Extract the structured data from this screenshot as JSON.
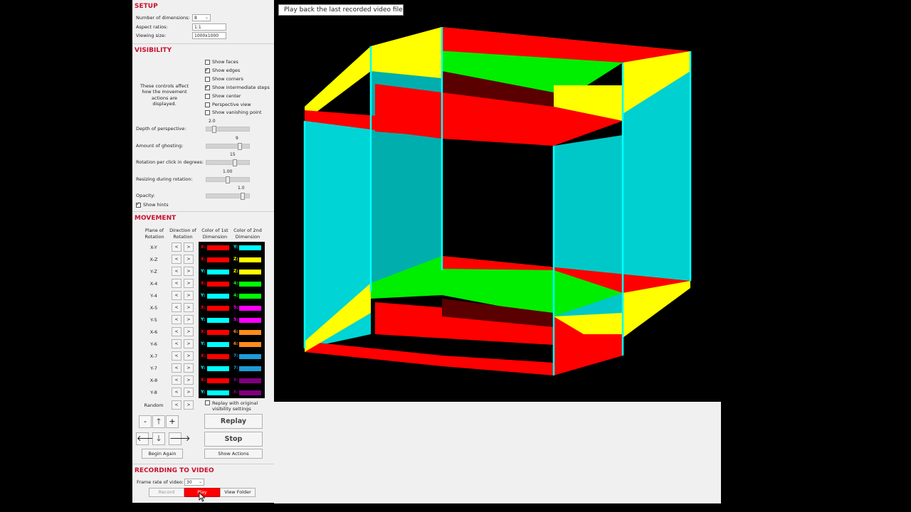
{
  "setup": {
    "title": "SETUP",
    "dimensions_label": "Number of dimensions:",
    "dimensions_value": "8",
    "aspect_label": "Aspect ratios:",
    "aspect_value": "1:1",
    "viewing_label": "Viewing size:",
    "viewing_value": "1000x1000"
  },
  "visibility": {
    "title": "VISIBILITY",
    "hint_text": "These controls affect how the movement actions are displayed.",
    "checkboxes": [
      {
        "label": "Show faces",
        "checked": false
      },
      {
        "label": "Show edges",
        "checked": true
      },
      {
        "label": "Show corners",
        "checked": false
      },
      {
        "label": "Show intermediate steps",
        "checked": true
      },
      {
        "label": "Show center",
        "checked": false
      },
      {
        "label": "Perspective view",
        "checked": false
      },
      {
        "label": "Show vanishing point",
        "checked": false
      }
    ],
    "sliders": [
      {
        "label": "Depth of perspective:",
        "value": "2.0",
        "level": 0.15
      },
      {
        "label": "Amount of ghosting:",
        "value": "9",
        "level": 0.82
      },
      {
        "label": "Rotation per click in degrees:",
        "value": "15",
        "level": 0.68
      },
      {
        "label": "Resizing during rotation:",
        "value": "1.00",
        "level": 0.5
      },
      {
        "label": "Opacity:",
        "value": "1.0",
        "level": 0.88
      }
    ],
    "show_hints_label": "Show hints",
    "show_hints_checked": true
  },
  "movement": {
    "title": "MOVEMENT",
    "headers": {
      "plane": "Plane of Rotation",
      "direction": "Direction of Rotation",
      "color1": "Color of 1st Dimension",
      "color2": "Color of 2nd Dimension"
    },
    "left_arrow": "<",
    "right_arrow": ">",
    "rows": [
      {
        "plane": "X-Y",
        "d1": "X:",
        "c1": "#ff0000",
        "d2": "Y:",
        "c2": "#00ffff"
      },
      {
        "plane": "X-Z",
        "d1": "X:",
        "c1": "#ff0000",
        "d2": "Z:",
        "c2": "#ffff00"
      },
      {
        "plane": "Y-Z",
        "d1": "Y:",
        "c1": "#00ffff",
        "d2": "Z:",
        "c2": "#ffff00"
      },
      {
        "plane": "X-4",
        "d1": "X:",
        "c1": "#ff0000",
        "d2": "4:",
        "c2": "#00ff00"
      },
      {
        "plane": "Y-4",
        "d1": "Y:",
        "c1": "#00ffff",
        "d2": "4:",
        "c2": "#00ff00"
      },
      {
        "plane": "X-5",
        "d1": "X:",
        "c1": "#ff0000",
        "d2": "5:",
        "c2": "#ff00ff"
      },
      {
        "plane": "Y-5",
        "d1": "Y:",
        "c1": "#00ffff",
        "d2": "5:",
        "c2": "#ff00ff"
      },
      {
        "plane": "X-6",
        "d1": "X:",
        "c1": "#ff0000",
        "d2": "6:",
        "c2": "#ff8c1a"
      },
      {
        "plane": "Y-6",
        "d1": "Y:",
        "c1": "#00ffff",
        "d2": "6:",
        "c2": "#ff8c1a"
      },
      {
        "plane": "X-7",
        "d1": "X:",
        "c1": "#ff0000",
        "d2": "7:",
        "c2": "#1e9bd7"
      },
      {
        "plane": "Y-7",
        "d1": "Y:",
        "c1": "#00ffff",
        "d2": "7:",
        "c2": "#1e9bd7"
      },
      {
        "plane": "X-8",
        "d1": "X:",
        "c1": "#ff0000",
        "d2": "8:",
        "c2": "#800080"
      },
      {
        "plane": "Y-8",
        "d1": "Y:",
        "c1": "#00ffff",
        "d2": "8:",
        "c2": "#800080"
      }
    ],
    "random_label": "Random",
    "replay_original_label": "Replay with original visibility settings",
    "replay_original_checked": false,
    "minus": "-",
    "plus": "+",
    "up": "🡑",
    "down": "🡓",
    "left": "🡐",
    "right": "🡒",
    "replay": "Replay",
    "stop": "Stop",
    "begin_again": "Begin Again",
    "show_actions": "Show Actions"
  },
  "recording": {
    "title": "RECORDING TO VIDEO",
    "frame_rate_label": "Frame rate of video:",
    "frame_rate_value": "30",
    "record": "Record",
    "play": "Play",
    "view_folder": "View Folder",
    "play_color": "#ff0000"
  },
  "stage": {
    "hint_banner": "Play back the last recorded video file"
  },
  "colors": {
    "red": "#ff0000",
    "cyan": "#00ffff",
    "yellow": "#ffff00",
    "green": "#00ff00",
    "dark_red": "#5a0000",
    "section_title": "#c8102e"
  }
}
